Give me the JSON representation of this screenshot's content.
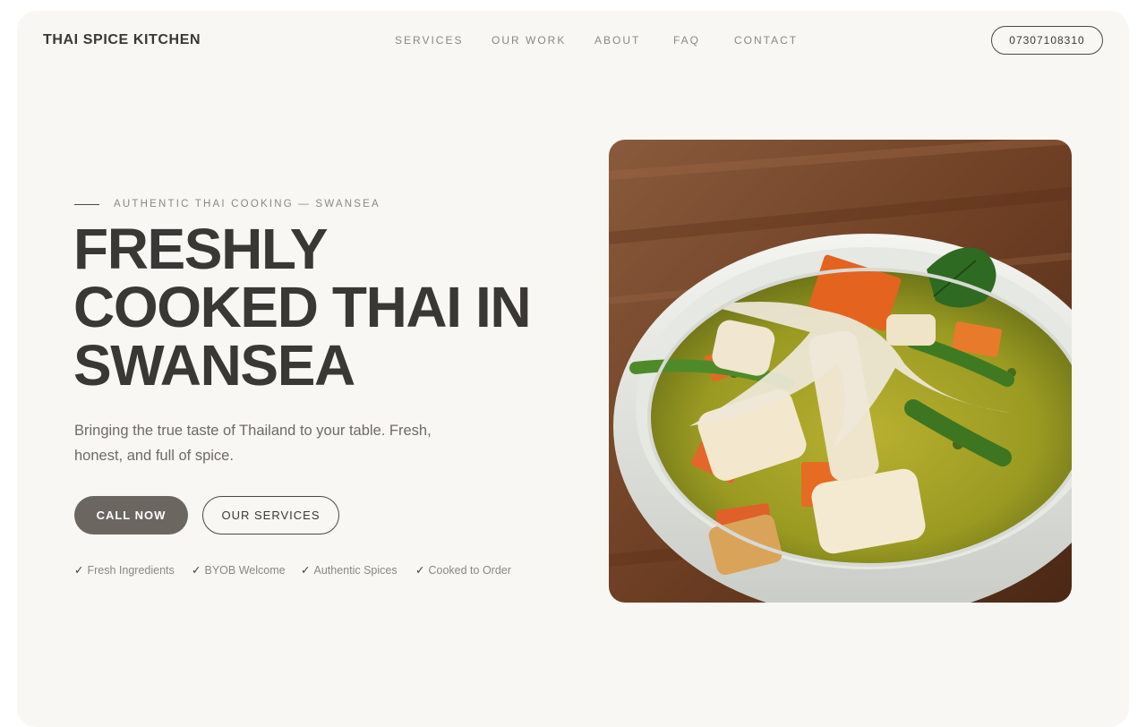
{
  "header": {
    "brand": "THAI SPICE KITCHEN",
    "nav": [
      "SERVICES",
      "OUR WORK",
      "ABOUT",
      "FAQ",
      "CONTACT"
    ],
    "phone": "07307108310"
  },
  "hero": {
    "eyebrow": "AUTHENTIC THAI COOKING — SWANSEA",
    "headline": [
      "FRESHLY",
      "COOKED THAI IN",
      "SWANSEA"
    ],
    "subtitle": "Bringing the true taste of Thailand to your table. Fresh, honest, and full of spice.",
    "primary_button": "CALL NOW",
    "secondary_button": "OUR SERVICES",
    "features": [
      "Fresh Ingredients",
      "BYOB Welcome",
      "Authentic Spices",
      "Cooked to Order"
    ],
    "check_glyph": "✓",
    "image_icon": "thai-soup-bowl-photo"
  },
  "colors": {
    "background": "#f8f7f4",
    "text": "#3a3835",
    "muted": "#8a8883",
    "primary_button": "#6b6660"
  }
}
